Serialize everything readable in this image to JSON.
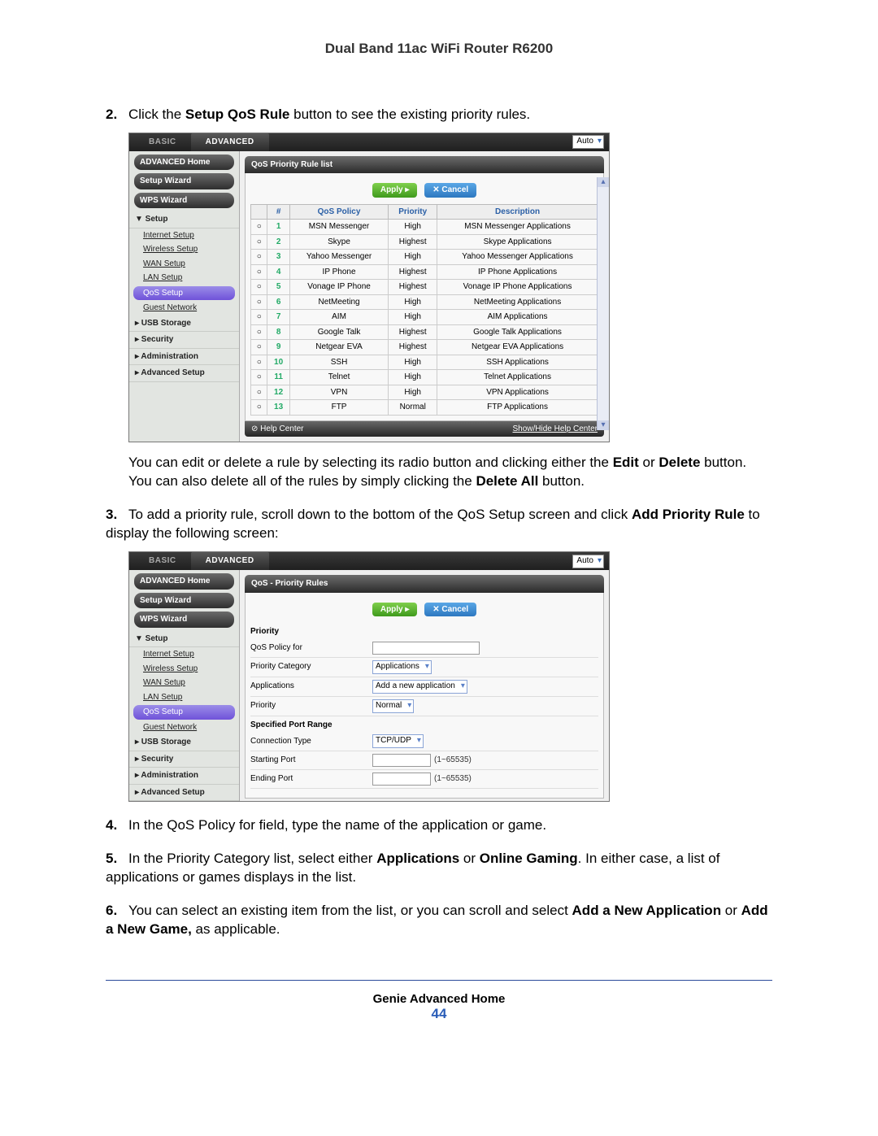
{
  "doc": {
    "title": "Dual Band 11ac WiFi Router R6200"
  },
  "steps": {
    "s2_pre": "Click the ",
    "s2_bold": "Setup QoS Rule",
    "s2_post": " button to see the existing priority rules.",
    "s2_after_a": "You can edit or delete a rule by selecting its radio button and clicking either the ",
    "s2_after_edit": "Edit",
    "s2_after_b": " or ",
    "s2_after_delete": "Delete",
    "s2_after_c": " button. You can also delete all of the rules by simply clicking the ",
    "s2_after_da": "Delete All",
    "s2_after_d": " button.",
    "s3_a": "To add a priority rule, scroll down to the bottom of the QoS Setup screen and click ",
    "s3_bold": "Add Priority Rule",
    "s3_b": " to display the following screen:",
    "s4": "In the QoS Policy for field, type the name of the application or game.",
    "s5_a": "In the Priority Category list, select either ",
    "s5_apps": "Applications",
    "s5_b": " or ",
    "s5_og": "Online Gaming",
    "s5_c": ". In either case, a list of applications or games displays in the list.",
    "s6_a": "You can select an existing item from the list, or you can scroll and select ",
    "s6_addapp": "Add a New Application",
    "s6_b": " or ",
    "s6_addgame": "Add a New Game,",
    "s6_c": "  as applicable."
  },
  "router": {
    "tabs": {
      "basic": "BASIC",
      "advanced": "ADVANCED",
      "lang": "Auto"
    },
    "sidebar": {
      "home": "ADVANCED Home",
      "setup_wizard": "Setup Wizard",
      "wps_wizard": "WPS Wizard",
      "setup": "▼ Setup",
      "internet": "Internet Setup",
      "wireless": "Wireless Setup",
      "wan": "WAN Setup",
      "lan": "LAN Setup",
      "qos": "QoS Setup",
      "guest": "Guest Network",
      "usb": "▸ USB Storage",
      "security": "▸ Security",
      "admin": "▸ Administration",
      "advsetup": "▸ Advanced Setup"
    },
    "panel1": {
      "title": "QoS Priority Rule list",
      "apply": "Apply ▸",
      "cancel": "✕ Cancel",
      "headers": [
        "",
        "#",
        "QoS Policy",
        "Priority",
        "Description"
      ],
      "rows": [
        [
          "1",
          "MSN Messenger",
          "High",
          "MSN Messenger Applications"
        ],
        [
          "2",
          "Skype",
          "Highest",
          "Skype Applications"
        ],
        [
          "3",
          "Yahoo Messenger",
          "High",
          "Yahoo Messenger Applications"
        ],
        [
          "4",
          "IP Phone",
          "Highest",
          "IP Phone Applications"
        ],
        [
          "5",
          "Vonage IP Phone",
          "Highest",
          "Vonage IP Phone Applications"
        ],
        [
          "6",
          "NetMeeting",
          "High",
          "NetMeeting Applications"
        ],
        [
          "7",
          "AIM",
          "High",
          "AIM Applications"
        ],
        [
          "8",
          "Google Talk",
          "Highest",
          "Google Talk Applications"
        ],
        [
          "9",
          "Netgear EVA",
          "Highest",
          "Netgear EVA Applications"
        ],
        [
          "10",
          "SSH",
          "High",
          "SSH Applications"
        ],
        [
          "11",
          "Telnet",
          "High",
          "Telnet Applications"
        ],
        [
          "12",
          "VPN",
          "High",
          "VPN Applications"
        ],
        [
          "13",
          "FTP",
          "Normal",
          "FTP Applications"
        ]
      ],
      "help_l": "⊘ Help Center",
      "help_r": "Show/Hide Help Center"
    },
    "panel2": {
      "title": "QoS - Priority Rules",
      "apply": "Apply ▸",
      "cancel": "✕ Cancel",
      "priority_hdr": "Priority",
      "policy_for": "QoS Policy for",
      "category": "Priority Category",
      "category_val": "Applications",
      "applications": "Applications",
      "applications_val": "Add a new application",
      "priority": "Priority",
      "priority_val": "Normal",
      "port_hdr": "Specified Port Range",
      "conn_type": "Connection Type",
      "conn_type_val": "TCP/UDP",
      "start_port": "Starting Port",
      "end_port": "Ending Port",
      "range": "(1~65535)"
    }
  },
  "footer": {
    "title": "Genie Advanced Home",
    "page": "44"
  }
}
